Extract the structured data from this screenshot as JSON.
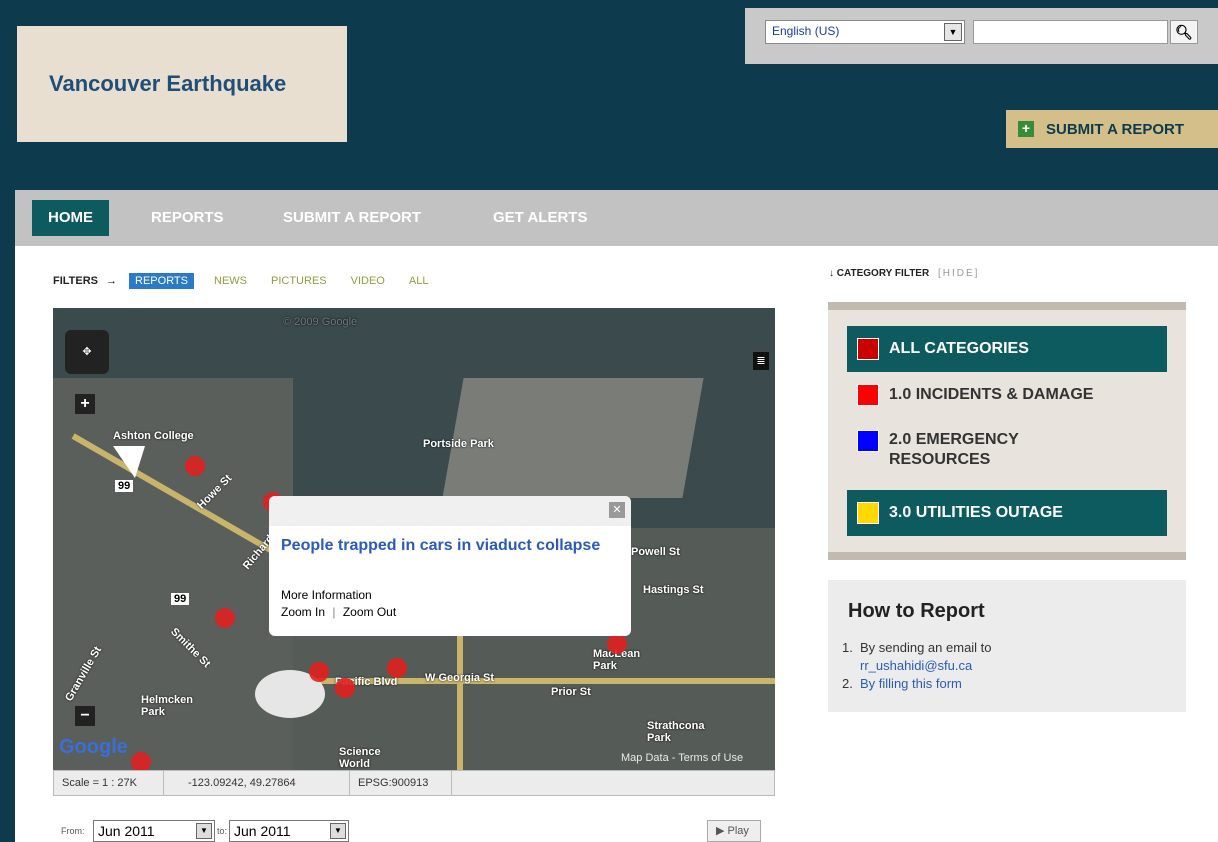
{
  "site": {
    "title": "Vancouver Earthquake"
  },
  "language": {
    "selected": "English (US)"
  },
  "search": {
    "placeholder": "",
    "icon": "search-icon"
  },
  "header": {
    "submit_label": "SUBMIT A REPORT"
  },
  "nav": {
    "home": "HOME",
    "reports": "REPORTS",
    "submit": "SUBMIT A REPORT",
    "alerts": "GET ALERTS"
  },
  "filters": {
    "label": "FILTERS",
    "items": [
      "REPORTS",
      "NEWS",
      "PICTURES",
      "VIDEO",
      "ALL"
    ]
  },
  "map": {
    "labels": [
      "Ashton College",
      "Portside Park",
      "Howe St",
      "Richards",
      "Powell St",
      "Hastings St",
      "Smithe St",
      "Granville St",
      "Pacific Blvd",
      "W Georgia St",
      "Prior St",
      "MacLean Park",
      "Strathcona Park",
      "Helmcken Park",
      "Science World",
      "99",
      "99"
    ],
    "attribution": "Map Data - Terms of Use",
    "google": "Google",
    "watermark": "© 2009 Google",
    "popup": {
      "title": "People trapped in cars in viaduct collapse",
      "more": "More Information",
      "zoom_in": "Zoom In",
      "sep": "|",
      "zoom_out": "Zoom Out"
    }
  },
  "map_status": {
    "scale": "Scale = 1 : 27K",
    "coords": "-123.09242, 49.27864",
    "epsg": "EPSG:900913"
  },
  "timeline": {
    "from_label": "From:",
    "from_value": "Jun 2011",
    "to_label": "to:",
    "to_value": "Jun 2011",
    "play": "Play"
  },
  "category_filter": {
    "title": "CATEGORY FILTER",
    "hide": "[HIDE]"
  },
  "categories": [
    {
      "label": "ALL CATEGORIES",
      "color": "#cc0000"
    },
    {
      "label": "1.0 INCIDENTS & DAMAGE",
      "color": "#ff0000"
    },
    {
      "label": "2.0 EMERGENCY RESOURCES",
      "color": "#0000ff"
    },
    {
      "label": "3.0 UTILITIES OUTAGE",
      "color": "#ffd800"
    }
  ],
  "how_to": {
    "title": "How to Report",
    "item1_prefix": "By sending an email to",
    "email": "rr_ushahidi@sfu.ca",
    "item2": "By filling this form"
  }
}
